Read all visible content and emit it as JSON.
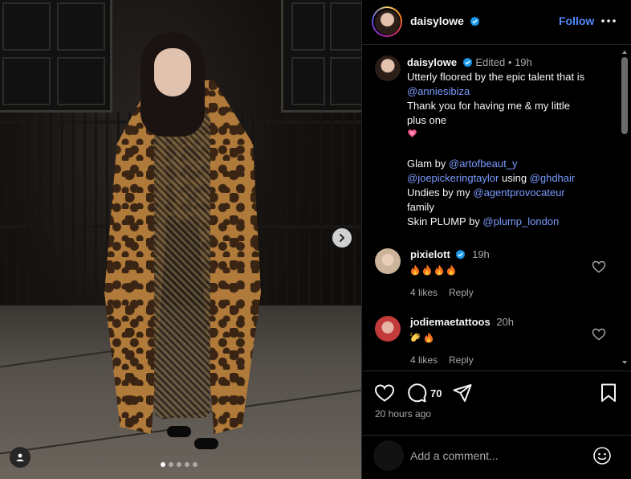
{
  "post": {
    "author": "daisylowe",
    "follow_label": "Follow",
    "caption": {
      "username": "daisylowe",
      "edited": "Edited",
      "separator": "•",
      "time": "19h",
      "line1": "Utterly floored by the epic talent that is",
      "mention1": "@anniesibiza",
      "line2": "Thank you for having me & my little plus one",
      "glam_prefix": "Glam by ",
      "mention_glam": "@artofbeaut_y",
      "mention_joe": "@joepickeringtaylor",
      "using": " using ",
      "mention_ghd": "@ghdhair",
      "undies_prefix": "Undies by my ",
      "mention_agent": "@agentprovocateur",
      "family": "family",
      "skin_prefix": "Skin PLUMP by ",
      "mention_plump": "@plump_london"
    },
    "comments": [
      {
        "username": "pixielott",
        "time": "19h",
        "likes": "4 likes",
        "reply": "Reply",
        "emoji": [
          "fire",
          "fire",
          "fire",
          "fire"
        ]
      },
      {
        "username": "jodiemaetattoos",
        "time": "20h",
        "likes": "4 likes",
        "reply": "Reply",
        "emoji": [
          "clap",
          "fire"
        ]
      }
    ],
    "comment_count": "70",
    "posted_ago": "20 hours ago",
    "add_comment_placeholder": "Add a comment...",
    "carousel": {
      "total": 5,
      "active_index": 0
    }
  },
  "icons": {
    "verified": "verified-badge-icon",
    "more": "more-options-icon",
    "like": "heart-icon",
    "comment": "comment-bubble-icon",
    "share": "send-icon",
    "save": "bookmark-icon",
    "emoji": "smiley-icon",
    "next": "chevron-right-icon",
    "tag": "user-tag-icon"
  },
  "colors": {
    "link": "#7a9bff",
    "follow": "#4f8cff",
    "verified": "#1d9bf0",
    "background": "#000000",
    "muted": "#a8a8a8"
  }
}
